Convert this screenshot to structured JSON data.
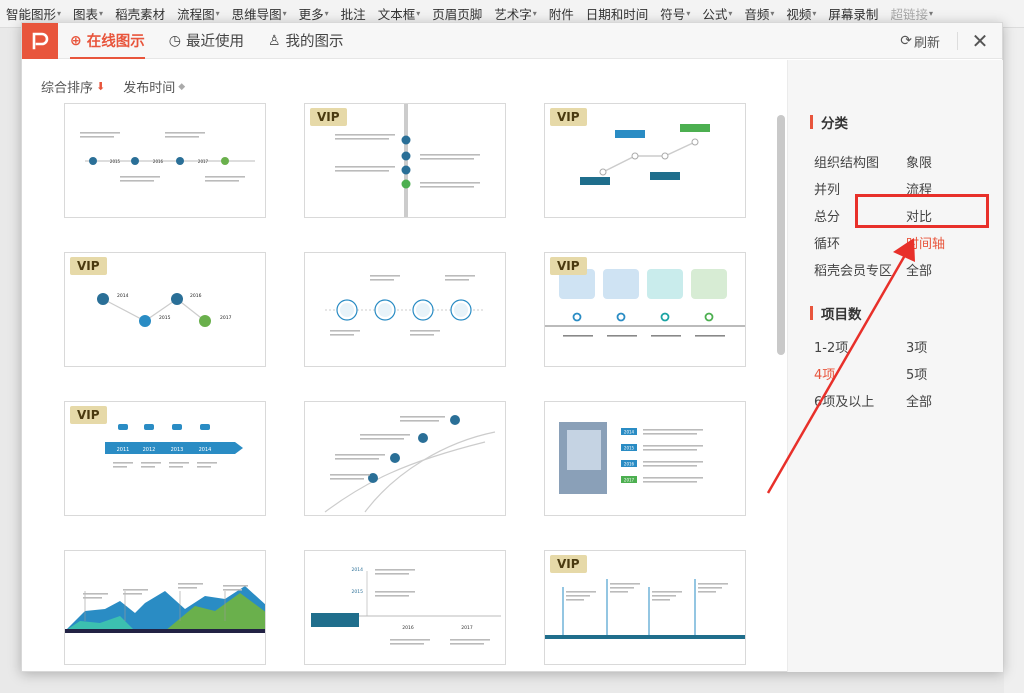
{
  "ribbon": {
    "items": [
      {
        "label": "智能图形",
        "caret": true
      },
      {
        "label": "图表",
        "caret": true
      },
      {
        "label": "稻壳素材",
        "caret": false
      },
      {
        "label": "流程图",
        "caret": true
      },
      {
        "label": "思维导图",
        "caret": true
      },
      {
        "label": "更多",
        "caret": true
      },
      {
        "label": "批注",
        "caret": false
      },
      {
        "label": "文本框",
        "caret": true
      },
      {
        "label": "页眉页脚",
        "caret": false
      },
      {
        "label": "艺术字",
        "caret": true
      },
      {
        "label": "附件",
        "caret": false
      },
      {
        "label": "日期和时间",
        "caret": false
      },
      {
        "label": "符号",
        "caret": true
      },
      {
        "label": "公式",
        "caret": true
      },
      {
        "label": "音频",
        "caret": true
      },
      {
        "label": "视频",
        "caret": true
      },
      {
        "label": "屏幕录制",
        "caret": false
      },
      {
        "label": "超链接",
        "caret": true
      }
    ]
  },
  "header": {
    "tabs": [
      {
        "label": "在线图示",
        "icon": "globe-icon",
        "active": true
      },
      {
        "label": "最近使用",
        "icon": "clock-icon",
        "active": false
      },
      {
        "label": "我的图示",
        "icon": "user-icon",
        "active": false
      }
    ],
    "refresh_label": "刷新",
    "close_glyph": "✕"
  },
  "sort": {
    "primary_label": "综合排序",
    "secondary_label": "发布时间"
  },
  "vip_label": "VIP",
  "cards": [
    {
      "vip": false,
      "kind": "t1"
    },
    {
      "vip": true,
      "kind": "t2"
    },
    {
      "vip": true,
      "kind": "t3"
    },
    {
      "vip": true,
      "kind": "t4"
    },
    {
      "vip": false,
      "kind": "t5"
    },
    {
      "vip": true,
      "kind": "t6"
    },
    {
      "vip": true,
      "kind": "t7"
    },
    {
      "vip": false,
      "kind": "t8"
    },
    {
      "vip": false,
      "kind": "t9"
    },
    {
      "vip": false,
      "kind": "t10"
    },
    {
      "vip": false,
      "kind": "t11"
    },
    {
      "vip": true,
      "kind": "t12"
    }
  ],
  "card_years": {
    "t1": [
      "2015",
      "2016",
      "2017"
    ],
    "t4": [
      "2014",
      "2016",
      "2015",
      "2017"
    ],
    "t7": [
      "2011",
      "2012",
      "2013",
      "2014"
    ],
    "t9": [
      "2014",
      "2015",
      "2016",
      "2017"
    ],
    "t11": [
      "2014",
      "2015",
      "2016",
      "2017"
    ]
  },
  "sidebar": {
    "category_title": "分类",
    "categories": [
      {
        "label": "组织结构图",
        "selected": false
      },
      {
        "label": "象限",
        "selected": false
      },
      {
        "label": "并列",
        "selected": false
      },
      {
        "label": "流程",
        "selected": false
      },
      {
        "label": "总分",
        "selected": false
      },
      {
        "label": "对比",
        "selected": false
      },
      {
        "label": "循环",
        "selected": false
      },
      {
        "label": "时间轴",
        "selected": true
      },
      {
        "label": "稻壳会员专区",
        "selected": false
      },
      {
        "label": "全部",
        "selected": false
      }
    ],
    "count_title": "项目数",
    "counts": [
      {
        "label": "1-2项",
        "selected": false
      },
      {
        "label": "3项",
        "selected": false
      },
      {
        "label": "4项",
        "selected": true
      },
      {
        "label": "5项",
        "selected": false
      },
      {
        "label": "6项及以上",
        "selected": false
      },
      {
        "label": "全部",
        "selected": false
      }
    ]
  },
  "colors": {
    "accent": "#e8553c",
    "annotation_red": "#e8302a",
    "vip_bg": "#e6d9a8"
  }
}
